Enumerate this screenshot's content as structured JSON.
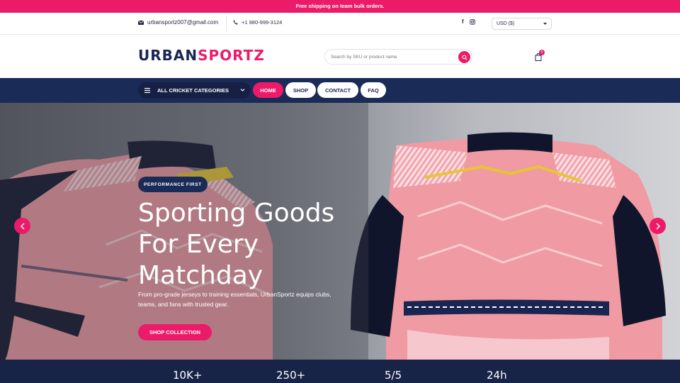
{
  "announcement": "Free shipping on team bulk orders.",
  "topbar": {
    "email": "urbansportz007@gmail.com",
    "phone": "+1 980-999-3124",
    "social": [
      "facebook-icon",
      "instagram-icon"
    ],
    "currency": "USD ($)"
  },
  "header": {
    "logo_part1": "URBAN",
    "logo_part2": "SPORTZ",
    "search_placeholder": "Search by SKU or product name",
    "cart_count": "0"
  },
  "nav": {
    "categories_label": "ALL CRICKET CATEGORIES",
    "items": [
      {
        "label": "HOME",
        "active": true
      },
      {
        "label": "SHOP",
        "active": false
      },
      {
        "label": "CONTACT",
        "active": false
      },
      {
        "label": "FAQ",
        "active": false
      }
    ]
  },
  "hero": {
    "badge": "PERFORMANCE FIRST",
    "title_line1": "Sporting Goods",
    "title_line2": "For Every",
    "title_line3": "Matchday",
    "subtitle": "From pro-grade jerseys to training essentials, UrbanSportz equips clubs, teams, and fans with trusted gear.",
    "cta": "SHOP COLLECTION"
  },
  "stats": [
    "10K+",
    "250+",
    "5/5",
    "24h"
  ],
  "colors": {
    "accent": "#ec1b6a",
    "navy": "#1b2b57",
    "dark_navy": "#172447"
  }
}
